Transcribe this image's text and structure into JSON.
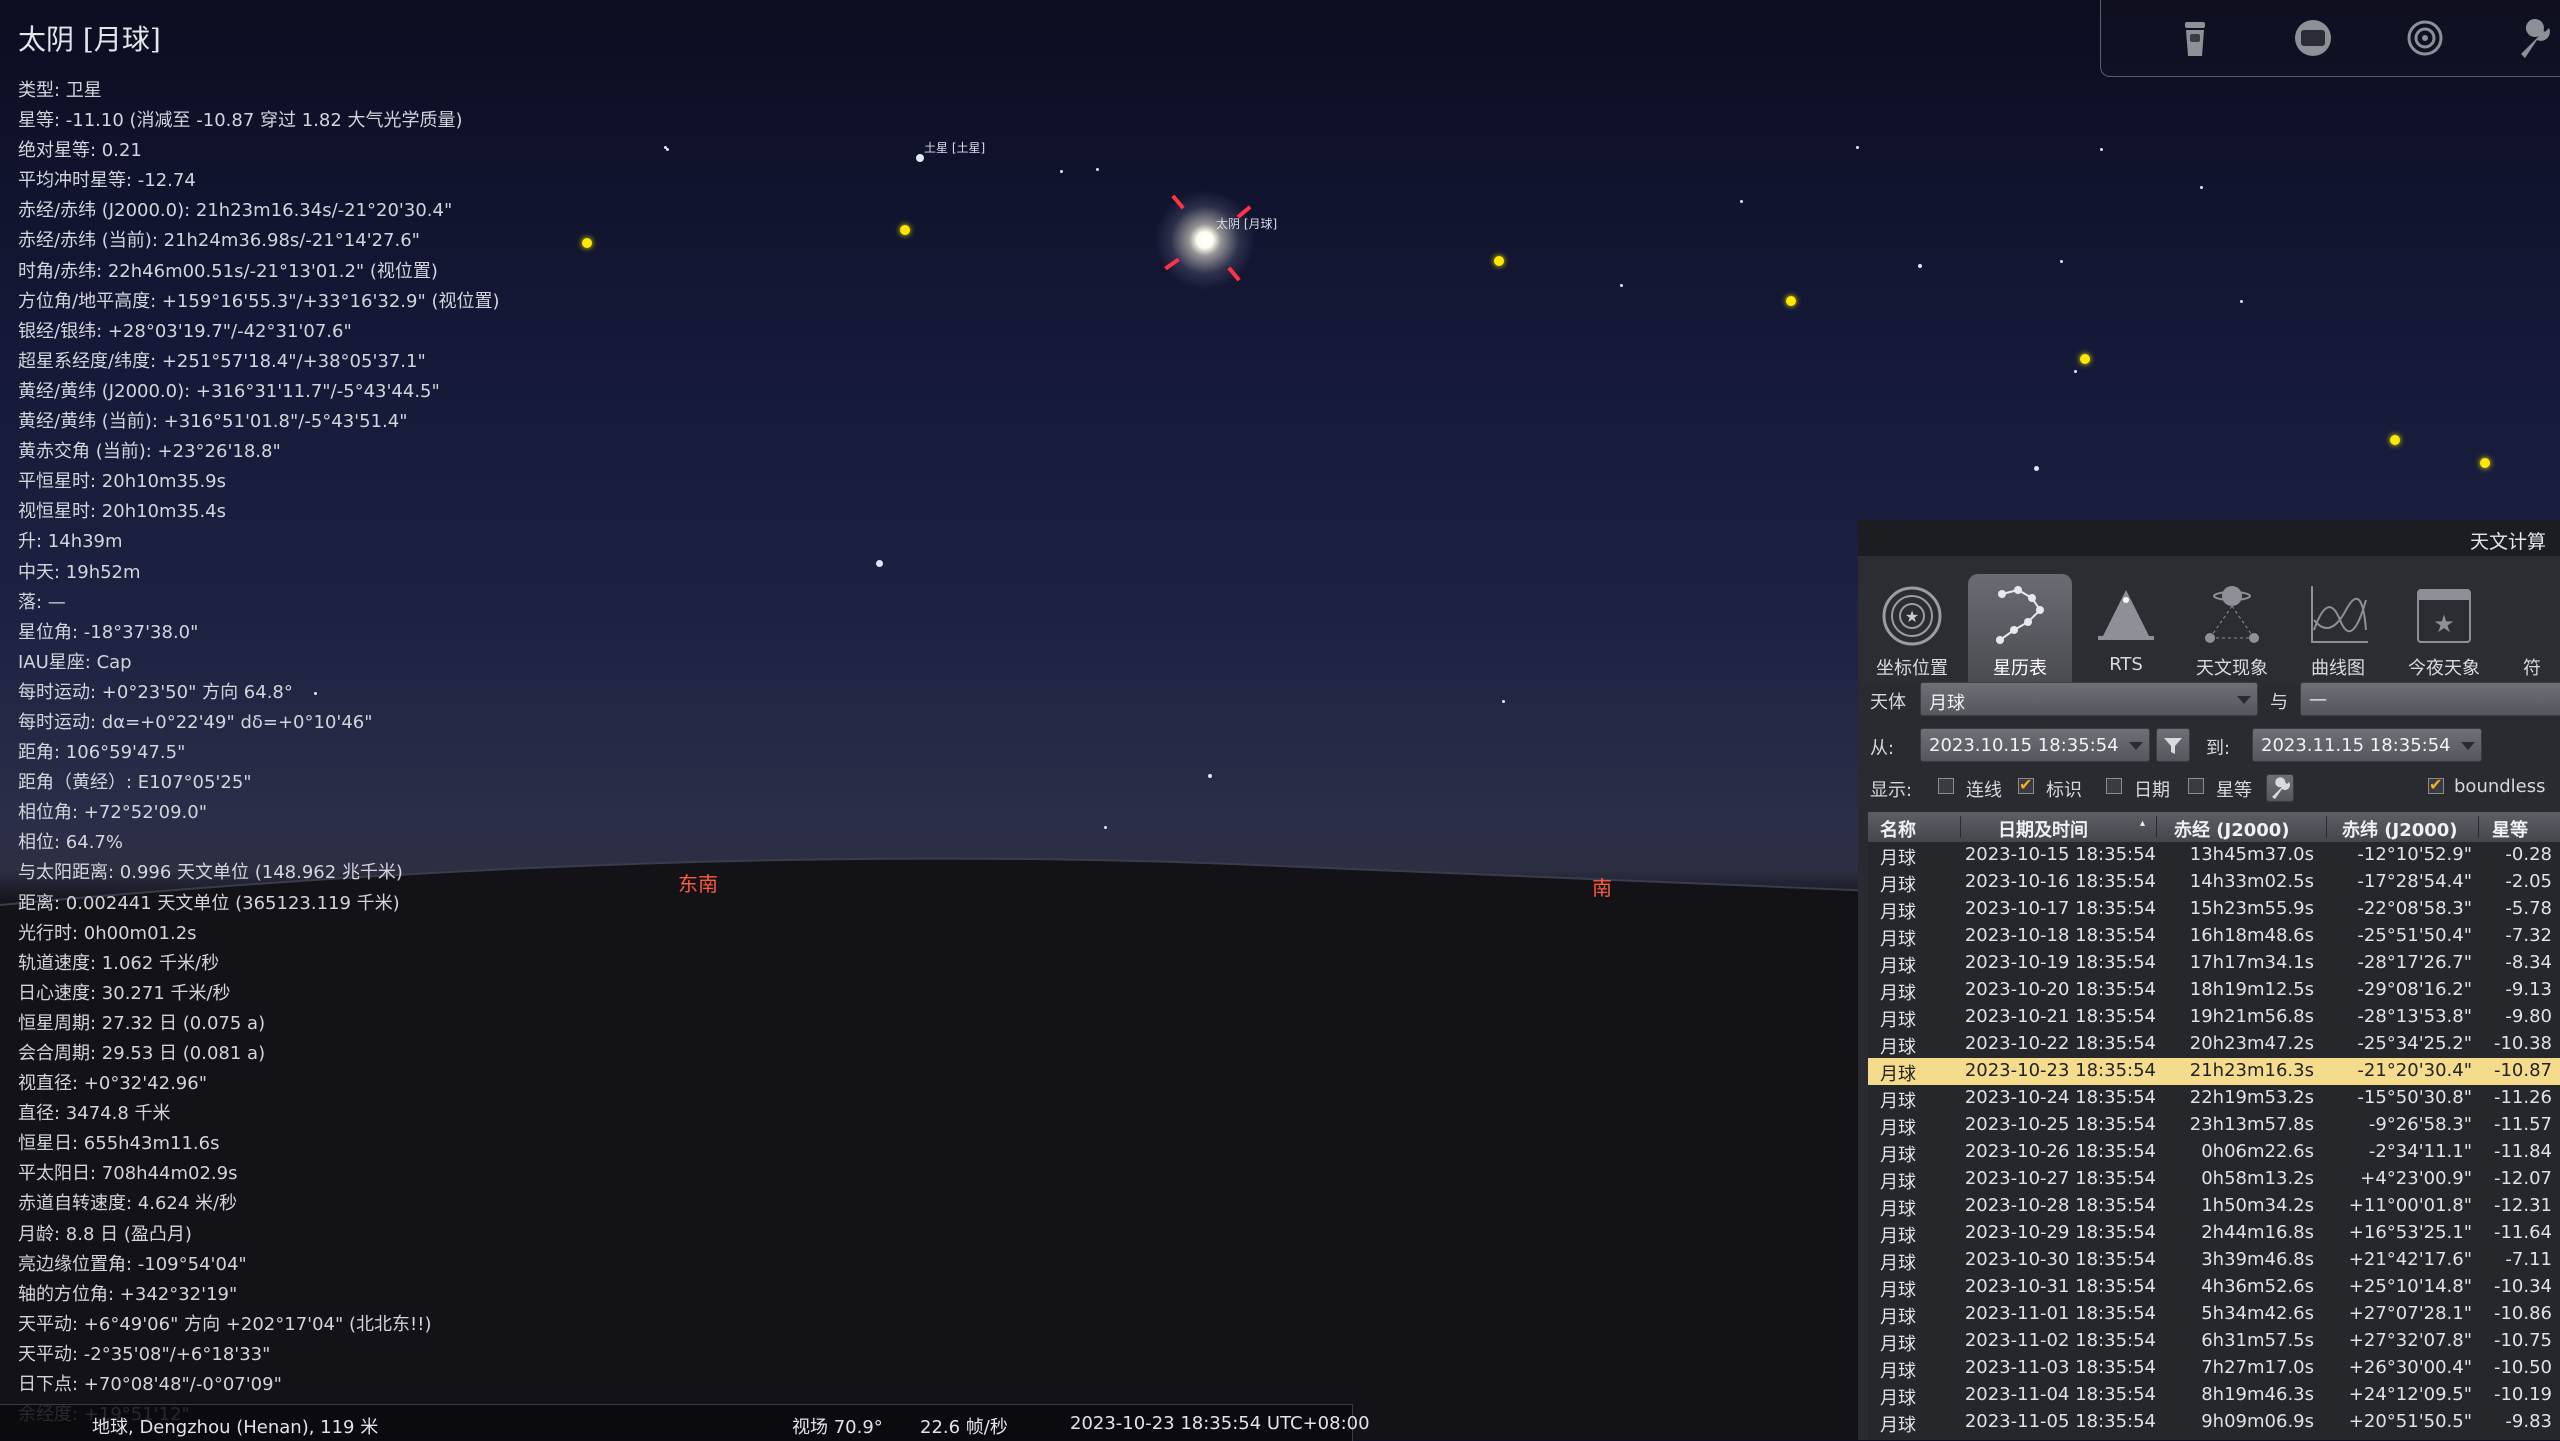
{
  "info": {
    "title": "太阴 [月球]",
    "lines": [
      "类型: 卫星",
      "星等: -11.10 (消减至 -10.87 穿过 1.82 大气光学质量)",
      "绝对星等: 0.21",
      "平均冲时星等: -12.74",
      "赤经/赤纬 (J2000.0): 21h23m16.34s/-21°20'30.4\"",
      "赤经/赤纬 (当前): 21h24m36.98s/-21°14'27.6\"",
      "时角/赤纬: 22h46m00.51s/-21°13'01.2\" (视位置)",
      "方位角/地平高度: +159°16'55.3\"/+33°16'32.9\" (视位置)",
      "银经/银纬: +28°03'19.7\"/-42°31'07.6\"",
      "超星系经度/纬度: +251°57'18.4\"/+38°05'37.1\"",
      "黄经/黄纬 (J2000.0): +316°31'11.7\"/-5°43'44.5\"",
      "黄经/黄纬 (当前): +316°51'01.8\"/-5°43'51.4\"",
      "黄赤交角 (当前): +23°26'18.8\"",
      "平恒星时: 20h10m35.9s",
      "视恒星时: 20h10m35.4s",
      "升: 14h39m",
      "中天: 19h52m",
      "落: —",
      "星位角: -18°37'38.0\"",
      "IAU星座: Cap",
      "每时运动: +0°23'50\" 方向 64.8°",
      "每时运动: dα=+0°22'49\" dδ=+0°10'46\"",
      "距角: 106°59'47.5\"",
      "距角（黄经）: E107°05'25\"",
      "相位角: +72°52'09.0\"",
      "相位: 64.7%",
      "与太阳距离: 0.996 天文单位 (148.962 兆千米)",
      "距离: 0.002441 天文单位 (365123.119 千米)",
      "光行时: 0h00m01.2s",
      "轨道速度: 1.062 千米/秒",
      "日心速度: 30.271 千米/秒",
      "恒星周期: 27.32 日 (0.075 a)",
      "会合周期: 29.53 日 (0.081 a)",
      "视直径: +0°32'42.96\"",
      "直径: 3474.8 千米",
      "恒星日: 655h43m11.6s",
      "平太阳日: 708h44m02.9s",
      "赤道自转速度: 4.624 米/秒",
      "月龄: 8.8 日 (盈凸月)",
      "亮边缘位置角: -109°54'04\"",
      "轴的方位角: +342°32'19\"",
      "天平动: +6°49'06\" 方向 +202°17'04\" (北北东!!)",
      "天平动: -2°35'08\"/+6°18'33\"",
      "日下点: +70°08'48\"/-0°07'09\"",
      "余经度: +19°51'12\""
    ]
  },
  "sky": {
    "saturn_label": "土星 [土星]",
    "moon_label": "太阴 [月球]",
    "compass_se": "东南",
    "compass_s": "南",
    "planet_color": "#ffe900",
    "marker_color": "#ff3344",
    "compass_color": "#ff5a3c"
  },
  "toolbar": {
    "buttons": [
      "trash-icon",
      "screen-icon",
      "target-icon",
      "wrench-icon"
    ]
  },
  "status": {
    "location": "地球, Dengzhou (Henan), 119 米",
    "fov": "视场 70.9°",
    "fps": "22.6 帧/秒",
    "datetime": "2023-10-23 18:35:54 UTC+08:00"
  },
  "calc": {
    "window_title": "天文计算",
    "tabs": [
      {
        "label": "坐标位置",
        "icon": "coordinates-icon"
      },
      {
        "label": "星历表",
        "icon": "ephemeris-icon"
      },
      {
        "label": "RTS",
        "icon": "rts-icon"
      },
      {
        "label": "天文现象",
        "icon": "phenomena-icon"
      },
      {
        "label": "曲线图",
        "icon": "graphs-icon"
      },
      {
        "label": "今夜天象",
        "icon": "whats-up-icon"
      },
      {
        "label": "符",
        "icon": "more-icon"
      }
    ],
    "active_tab": 1,
    "body_label": "天体",
    "body_value": "月球",
    "with_label": "与",
    "with_value": "—",
    "from_label": "从:",
    "from_value": "2023.10.15 18:35:54",
    "to_label": "到:",
    "to_value": "2023.11.15 18:35:54",
    "display_label": "显示:",
    "checkboxes": [
      {
        "label": "连线",
        "checked": false
      },
      {
        "label": "标识",
        "checked": true
      },
      {
        "label": "日期",
        "checked": false
      },
      {
        "label": "星等",
        "checked": false
      }
    ],
    "boundless_label": "boundless",
    "boundless_checked": true,
    "accent_color": "#f5dc8c",
    "columns": [
      "名称",
      "日期及时间",
      "赤经 (J2000)",
      "赤纬 (J2000)",
      "星等"
    ],
    "selected_row": 8,
    "rows": [
      [
        "月球",
        "2023-10-15 18:35:54",
        "13h45m37.0s",
        "-12°10'52.9\"",
        "-0.28"
      ],
      [
        "月球",
        "2023-10-16 18:35:54",
        "14h33m02.5s",
        "-17°28'54.4\"",
        "-2.05"
      ],
      [
        "月球",
        "2023-10-17 18:35:54",
        "15h23m55.9s",
        "-22°08'58.3\"",
        "-5.78"
      ],
      [
        "月球",
        "2023-10-18 18:35:54",
        "16h18m48.6s",
        "-25°51'50.4\"",
        "-7.32"
      ],
      [
        "月球",
        "2023-10-19 18:35:54",
        "17h17m34.1s",
        "-28°17'26.7\"",
        "-8.34"
      ],
      [
        "月球",
        "2023-10-20 18:35:54",
        "18h19m12.5s",
        "-29°08'16.2\"",
        "-9.13"
      ],
      [
        "月球",
        "2023-10-21 18:35:54",
        "19h21m56.8s",
        "-28°13'53.8\"",
        "-9.80"
      ],
      [
        "月球",
        "2023-10-22 18:35:54",
        "20h23m47.2s",
        "-25°34'25.2\"",
        "-10.38"
      ],
      [
        "月球",
        "2023-10-23 18:35:54",
        "21h23m16.3s",
        "-21°20'30.4\"",
        "-10.87"
      ],
      [
        "月球",
        "2023-10-24 18:35:54",
        "22h19m53.2s",
        "-15°50'30.8\"",
        "-11.26"
      ],
      [
        "月球",
        "2023-10-25 18:35:54",
        "23h13m57.8s",
        "-9°26'58.3\"",
        "-11.57"
      ],
      [
        "月球",
        "2023-10-26 18:35:54",
        "0h06m22.6s",
        "-2°34'11.1\"",
        "-11.84"
      ],
      [
        "月球",
        "2023-10-27 18:35:54",
        "0h58m13.2s",
        "+4°23'00.9\"",
        "-12.07"
      ],
      [
        "月球",
        "2023-10-28 18:35:54",
        "1h50m34.2s",
        "+11°00'01.8\"",
        "-12.31"
      ],
      [
        "月球",
        "2023-10-29 18:35:54",
        "2h44m16.8s",
        "+16°53'25.1\"",
        "-11.64"
      ],
      [
        "月球",
        "2023-10-30 18:35:54",
        "3h39m46.8s",
        "+21°42'17.6\"",
        "-7.11"
      ],
      [
        "月球",
        "2023-10-31 18:35:54",
        "4h36m52.6s",
        "+25°10'14.8\"",
        "-10.34"
      ],
      [
        "月球",
        "2023-11-01 18:35:54",
        "5h34m42.6s",
        "+27°07'28.1\"",
        "-10.86"
      ],
      [
        "月球",
        "2023-11-02 18:35:54",
        "6h31m57.5s",
        "+27°32'07.8\"",
        "-10.75"
      ],
      [
        "月球",
        "2023-11-03 18:35:54",
        "7h27m17.0s",
        "+26°30'00.4\"",
        "-10.50"
      ],
      [
        "月球",
        "2023-11-04 18:35:54",
        "8h19m46.3s",
        "+24°12'09.5\"",
        "-10.19"
      ],
      [
        "月球",
        "2023-11-05 18:35:54",
        "9h09m06.9s",
        "+20°51'50.5\"",
        "-9.83"
      ]
    ]
  }
}
